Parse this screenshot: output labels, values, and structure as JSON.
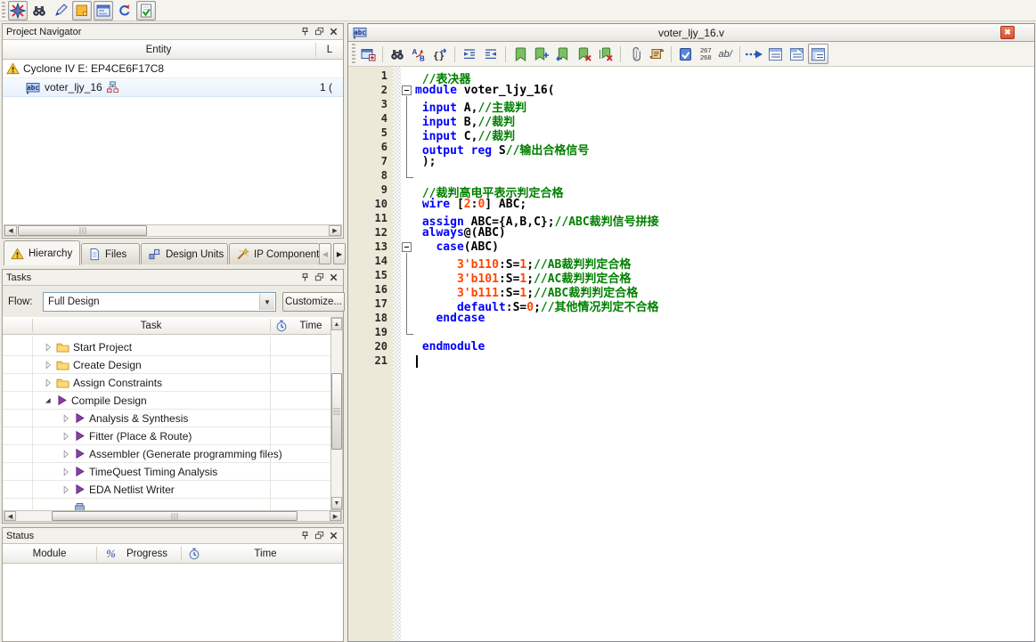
{
  "colors": {
    "keyword": "#0000ff",
    "comment": "#008000",
    "number": "#ff4500",
    "plain": "#000000",
    "accent_purple": "#8c3ba8",
    "close_red": "#dd4f33"
  },
  "top_toolbar": {
    "icons": [
      {
        "name": "compass-window-toggle",
        "icon": "compass",
        "pressed": true
      },
      {
        "name": "node-finder-toggle",
        "icon": "binoculars2",
        "pressed": false
      },
      {
        "name": "tcl-console-toggle",
        "icon": "pen",
        "pressed": false
      },
      {
        "name": "messages-toggle",
        "icon": "sticky",
        "pressed": true
      },
      {
        "name": "ip-catalog-toggle",
        "icon": "listpanel",
        "pressed": true
      },
      {
        "name": "refresh",
        "icon": "refresh",
        "pressed": false
      },
      {
        "name": "tasks-toggle",
        "icon": "checkdoc",
        "pressed": true
      }
    ]
  },
  "project_navigator": {
    "title": "Project Navigator",
    "columns": {
      "entity": "Entity",
      "logic": "L"
    },
    "rows": [
      {
        "label": "Cyclone IV E: EP4CE6F17C8",
        "icon": "warning",
        "value": "",
        "alt": false
      },
      {
        "label": "voter_ljy_16",
        "icon": "abc",
        "suffix_icon": "hier",
        "value": "1 (",
        "alt": true
      }
    ],
    "tabs": [
      {
        "label": "Hierarchy",
        "icon": "warning",
        "active": true
      },
      {
        "label": "Files",
        "icon": "filedoc",
        "active": false
      },
      {
        "label": "Design Units",
        "icon": "cubes",
        "active": false
      },
      {
        "label": "IP Component",
        "icon": "wand",
        "active": false
      }
    ]
  },
  "tasks": {
    "title": "Tasks",
    "flow_label": "Flow:",
    "flow_value": "Full Design",
    "customize_label": "Customize...",
    "columns": {
      "task": "Task",
      "time": "Time"
    },
    "rows": [
      {
        "label": "Start Project",
        "icon": "folder",
        "indent": 1,
        "arrow": "collapsed"
      },
      {
        "label": "Create Design",
        "icon": "folder",
        "indent": 1,
        "arrow": "collapsed"
      },
      {
        "label": "Assign Constraints",
        "icon": "folder",
        "indent": 1,
        "arrow": "collapsed"
      },
      {
        "label": "Compile Design",
        "icon": "play",
        "indent": 1,
        "arrow": "expanded"
      },
      {
        "label": "Analysis & Synthesis",
        "icon": "play",
        "indent": 2,
        "arrow": "collapsed"
      },
      {
        "label": "Fitter (Place & Route)",
        "icon": "play",
        "indent": 2,
        "arrow": "collapsed"
      },
      {
        "label": "Assembler (Generate programming files)",
        "icon": "play",
        "indent": 2,
        "arrow": "collapsed"
      },
      {
        "label": "TimeQuest Timing Analysis",
        "icon": "play",
        "indent": 2,
        "arrow": "collapsed"
      },
      {
        "label": "EDA Netlist Writer",
        "icon": "play",
        "indent": 2,
        "arrow": "collapsed"
      },
      {
        "label": "",
        "icon": "program",
        "indent": 2,
        "arrow": null,
        "partial": true
      }
    ]
  },
  "status": {
    "title": "Status",
    "columns": {
      "module": "Module",
      "percent": "%",
      "progress": "Progress",
      "time": "Time"
    }
  },
  "editor": {
    "title": "voter_ljy_16.v",
    "line_counter_top": "267",
    "line_counter_bottom": "268",
    "comment_label": "ab/",
    "toolbar": [
      {
        "t": "btn",
        "name": "open-in-new-window",
        "icon": "docwin"
      },
      {
        "t": "sep"
      },
      {
        "t": "btn",
        "name": "find",
        "icon": "binoculars2"
      },
      {
        "t": "btn",
        "name": "replace",
        "icon": "replace"
      },
      {
        "t": "btn",
        "name": "match-brace",
        "icon": "brace"
      },
      {
        "t": "sep"
      },
      {
        "t": "btn",
        "name": "increase-indent",
        "icon": "indent"
      },
      {
        "t": "btn",
        "name": "decrease-indent",
        "icon": "outdent"
      },
      {
        "t": "sep"
      },
      {
        "t": "btn",
        "name": "toggle-bookmark",
        "icon": "bookmark"
      },
      {
        "t": "btn",
        "name": "next-bookmark",
        "icon": "bookmarknext"
      },
      {
        "t": "btn",
        "name": "previous-bookmark",
        "icon": "bookmarkprev"
      },
      {
        "t": "btn",
        "name": "delete-bookmark",
        "icon": "bookmarkdel"
      },
      {
        "t": "btn",
        "name": "delete-all-bookmarks",
        "icon": "bookmarkdelall"
      },
      {
        "t": "sep"
      },
      {
        "t": "btn",
        "name": "attach",
        "icon": "paperclip"
      },
      {
        "t": "btn",
        "name": "record-macro",
        "icon": "scroll"
      },
      {
        "t": "sep"
      },
      {
        "t": "btn",
        "name": "analyze-current-file",
        "icon": "analyzedoc"
      },
      {
        "t": "counter",
        "name": "line-count-display"
      },
      {
        "t": "text",
        "name": "comment-tool",
        "bind": "editor.comment_label"
      },
      {
        "t": "sep"
      },
      {
        "t": "btn",
        "name": "goto-line",
        "icon": "arrowdashed"
      },
      {
        "t": "btn",
        "name": "fold-view-1",
        "icon": "docfold1"
      },
      {
        "t": "btn",
        "name": "fold-view-2",
        "icon": "docfold2"
      },
      {
        "t": "btn",
        "name": "outline-view",
        "icon": "docoutline",
        "pressed": true
      }
    ],
    "code": {
      "lines": [
        {
          "n": "1",
          "segs": [
            [
              " //表决器",
              "c"
            ]
          ]
        },
        {
          "n": "2",
          "fold": "start",
          "segs": [
            [
              "module",
              "k"
            ],
            [
              " voter_ljy_16(",
              "p"
            ]
          ]
        },
        {
          "n": "3",
          "fold": "mid",
          "segs": [
            [
              " ",
              "p"
            ],
            [
              "input",
              "k"
            ],
            [
              " A,",
              "p"
            ],
            [
              "//主裁判",
              "c"
            ]
          ]
        },
        {
          "n": "4",
          "fold": "mid",
          "segs": [
            [
              " ",
              "p"
            ],
            [
              "input",
              "k"
            ],
            [
              " B,",
              "p"
            ],
            [
              "//裁判",
              "c"
            ]
          ]
        },
        {
          "n": "5",
          "fold": "mid",
          "segs": [
            [
              " ",
              "p"
            ],
            [
              "input",
              "k"
            ],
            [
              " C,",
              "p"
            ],
            [
              "//裁判",
              "c"
            ]
          ]
        },
        {
          "n": "6",
          "fold": "mid",
          "segs": [
            [
              " ",
              "p"
            ],
            [
              "output",
              "k"
            ],
            [
              " ",
              "p"
            ],
            [
              "reg",
              "k"
            ],
            [
              " S",
              "p"
            ],
            [
              "//输出合格信号",
              "c"
            ]
          ]
        },
        {
          "n": "7",
          "fold": "mid",
          "segs": [
            [
              " );",
              "p"
            ]
          ]
        },
        {
          "n": "8",
          "fold": "end",
          "segs": []
        },
        {
          "n": "9",
          "segs": [
            [
              " ",
              "p"
            ],
            [
              "//裁判高电平表示判定合格",
              "c"
            ]
          ]
        },
        {
          "n": "10",
          "segs": [
            [
              " ",
              "p"
            ],
            [
              "wire",
              "k"
            ],
            [
              " [",
              "p"
            ],
            [
              "2",
              "n"
            ],
            [
              ":",
              "p"
            ],
            [
              "0",
              "n"
            ],
            [
              "] ABC;",
              "p"
            ]
          ]
        },
        {
          "n": "11",
          "segs": [
            [
              " ",
              "p"
            ],
            [
              "assign",
              "k"
            ],
            [
              " ABC={A,B,C};",
              "p"
            ],
            [
              "//ABC裁判信号拼接",
              "c"
            ]
          ]
        },
        {
          "n": "12",
          "segs": [
            [
              " ",
              "p"
            ],
            [
              "always",
              "k"
            ],
            [
              "@(ABC)",
              "p"
            ]
          ]
        },
        {
          "n": "13",
          "fold": "start",
          "segs": [
            [
              "   ",
              "p"
            ],
            [
              "case",
              "k"
            ],
            [
              "(ABC)",
              "p"
            ]
          ]
        },
        {
          "n": "14",
          "fold": "mid",
          "segs": [
            [
              "      ",
              "p"
            ],
            [
              "3'b110",
              "n"
            ],
            [
              ":S=",
              "p"
            ],
            [
              "1",
              "n"
            ],
            [
              ";",
              "p"
            ],
            [
              "//AB裁判判定合格",
              "c"
            ]
          ]
        },
        {
          "n": "15",
          "fold": "mid",
          "segs": [
            [
              "      ",
              "p"
            ],
            [
              "3'b101",
              "n"
            ],
            [
              ":S=",
              "p"
            ],
            [
              "1",
              "n"
            ],
            [
              ";",
              "p"
            ],
            [
              "//AC裁判判定合格",
              "c"
            ]
          ]
        },
        {
          "n": "16",
          "fold": "mid",
          "segs": [
            [
              "      ",
              "p"
            ],
            [
              "3'b111",
              "n"
            ],
            [
              ":S=",
              "p"
            ],
            [
              "1",
              "n"
            ],
            [
              ";",
              "p"
            ],
            [
              "//ABC裁判判定合格",
              "c"
            ]
          ]
        },
        {
          "n": "17",
          "fold": "mid",
          "segs": [
            [
              "      ",
              "p"
            ],
            [
              "default",
              "k"
            ],
            [
              ":S=",
              "p"
            ],
            [
              "0",
              "n"
            ],
            [
              ";",
              "p"
            ],
            [
              "//其他情况判定不合格",
              "c"
            ]
          ]
        },
        {
          "n": "18",
          "fold": "mid",
          "segs": [
            [
              "   ",
              "p"
            ],
            [
              "endcase",
              "k"
            ]
          ]
        },
        {
          "n": "19",
          "fold": "end",
          "segs": []
        },
        {
          "n": "20",
          "segs": [
            [
              " ",
              "p"
            ],
            [
              "endmodule",
              "k"
            ]
          ]
        },
        {
          "n": "21",
          "cursor": true,
          "segs": []
        }
      ]
    }
  }
}
